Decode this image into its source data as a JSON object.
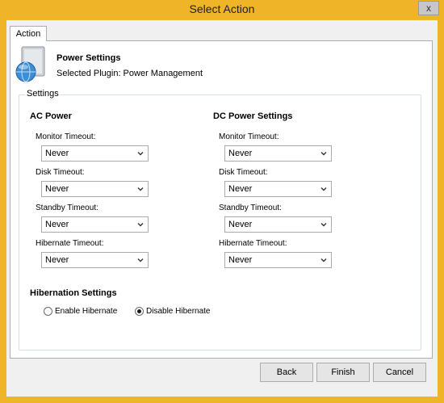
{
  "window": {
    "title": "Select Action",
    "close_glyph": "x"
  },
  "tab": {
    "label": "Action"
  },
  "plugin": {
    "title": "Power Settings",
    "subtitle": "Selected Plugin: Power Management",
    "icon": "power-plugin-icon"
  },
  "settings": {
    "legend": "Settings",
    "ac": {
      "title": "AC Power",
      "fields": [
        {
          "label": "Monitor Timeout:",
          "value": "Never"
        },
        {
          "label": "Disk Timeout:",
          "value": "Never"
        },
        {
          "label": "Standby Timeout:",
          "value": "Never"
        },
        {
          "label": "Hibernate Timeout:",
          "value": "Never"
        }
      ]
    },
    "dc": {
      "title": "DC Power Settings",
      "fields": [
        {
          "label": "Monitor Timeout:",
          "value": "Never"
        },
        {
          "label": "Disk Timeout:",
          "value": "Never"
        },
        {
          "label": "Standby Timeout:",
          "value": "Never"
        },
        {
          "label": "Hibernate Timeout:",
          "value": "Never"
        }
      ]
    },
    "hibernation": {
      "title": "Hibernation Settings",
      "options": [
        {
          "label": "Enable Hibernate",
          "selected": false
        },
        {
          "label": "Disable Hibernate",
          "selected": true
        }
      ]
    }
  },
  "buttons": {
    "back": "Back",
    "finish": "Finish",
    "cancel": "Cancel"
  },
  "colors": {
    "frame": "#f0b429",
    "panel": "#ffffff",
    "client": "#f0f0f0"
  }
}
